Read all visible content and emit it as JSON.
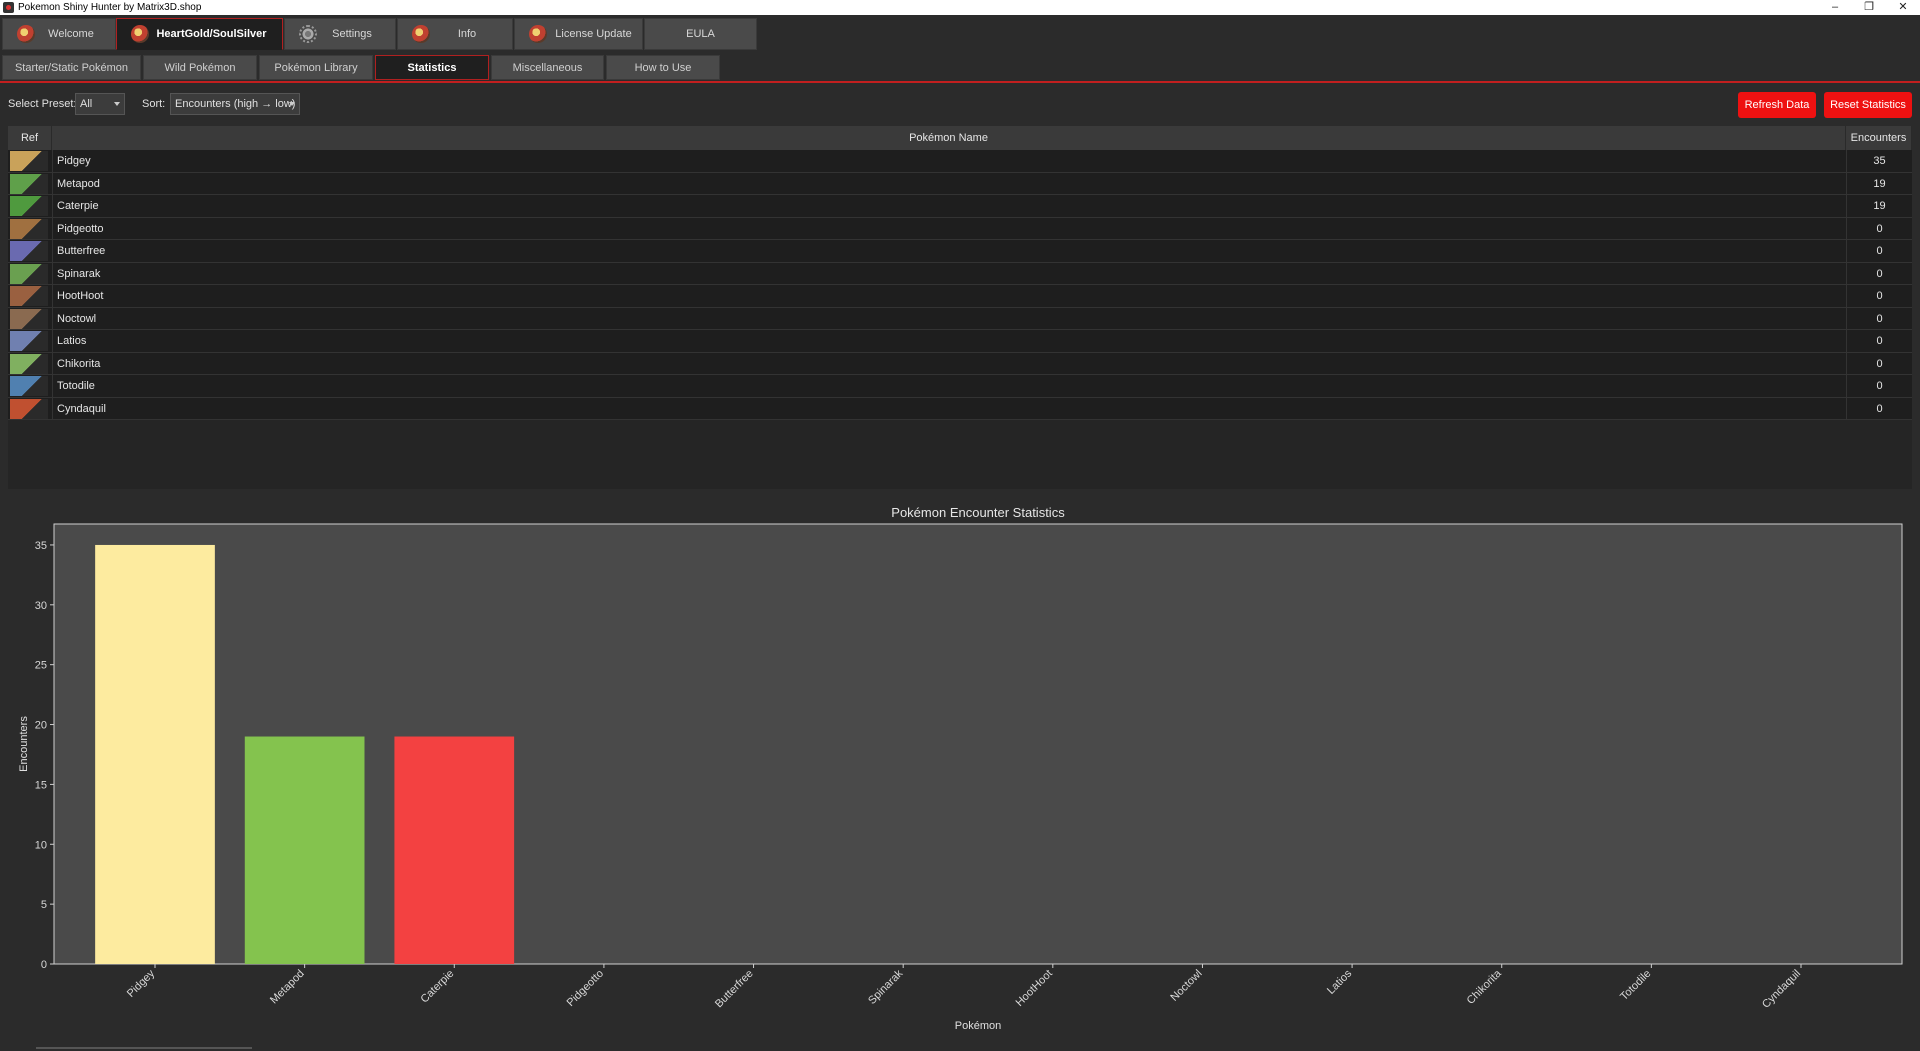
{
  "window": {
    "title": "Pokemon Shiny Hunter by Matrix3D.shop",
    "controls": [
      "minimize",
      "restore",
      "close"
    ]
  },
  "main_tabs": [
    {
      "label": "Welcome",
      "icon": "pokeball-icon"
    },
    {
      "label": "HeartGold/SoulSilver",
      "icon": "pokeball-icon",
      "active": true
    },
    {
      "label": "Settings",
      "icon": "gear-icon"
    },
    {
      "label": "Info",
      "icon": "pokeball-icon"
    },
    {
      "label": "License Update",
      "icon": "license-icon"
    },
    {
      "label": "EULA"
    }
  ],
  "sub_tabs": [
    {
      "label": "Starter/Static Pokémon"
    },
    {
      "label": "Wild Pokémon"
    },
    {
      "label": "Pokémon Library"
    },
    {
      "label": "Statistics",
      "active": true
    },
    {
      "label": "Miscellaneous"
    },
    {
      "label": "How to Use"
    }
  ],
  "toolbar": {
    "preset_label": "Select Preset:",
    "preset_value": "All",
    "sort_label": "Sort:",
    "sort_value": "Encounters (high → low)",
    "refresh_label": "Refresh Data",
    "reset_label": "Reset Statistics"
  },
  "table": {
    "columns": [
      "Ref",
      "Pokémon Name",
      "Encounters"
    ],
    "rows": [
      {
        "name": "Pidgey",
        "encounters": "35",
        "sprite_color": "#c9a25a"
      },
      {
        "name": "Metapod",
        "encounters": "19",
        "sprite_color": "#5fa04a"
      },
      {
        "name": "Caterpie",
        "encounters": "19",
        "sprite_color": "#4f9a3e"
      },
      {
        "name": "Pidgeotto",
        "encounters": "0",
        "sprite_color": "#a07040"
      },
      {
        "name": "Butterfree",
        "encounters": "0",
        "sprite_color": "#6a6ab0"
      },
      {
        "name": "Spinarak",
        "encounters": "0",
        "sprite_color": "#6aa050"
      },
      {
        "name": "HootHoot",
        "encounters": "0",
        "sprite_color": "#9a6040"
      },
      {
        "name": "Noctowl",
        "encounters": "0",
        "sprite_color": "#8a6a50"
      },
      {
        "name": "Latios",
        "encounters": "0",
        "sprite_color": "#7080b0"
      },
      {
        "name": "Chikorita",
        "encounters": "0",
        "sprite_color": "#80b060"
      },
      {
        "name": "Totodile",
        "encounters": "0",
        "sprite_color": "#5080b0"
      },
      {
        "name": "Cyndaquil",
        "encounters": "0",
        "sprite_color": "#c05030"
      }
    ]
  },
  "colors": {
    "accent_red": "#ee1111",
    "bar_colors": [
      "#fdeb9f",
      "#84c34e",
      "#f34141"
    ],
    "plot_bg": "#4a4a4a"
  },
  "chart_data": {
    "type": "bar",
    "title": "Pokémon Encounter Statistics",
    "xlabel": "Pokémon",
    "ylabel": "Encounters",
    "categories": [
      "Pidgey",
      "Metapod",
      "Caterpie",
      "Pidgeotto",
      "Butterfree",
      "Spinarak",
      "HootHoot",
      "Noctowl",
      "Latios",
      "Chikorita",
      "Totodile",
      "Cyndaquil"
    ],
    "values": [
      35,
      19,
      19,
      0,
      0,
      0,
      0,
      0,
      0,
      0,
      0,
      0
    ],
    "ylim": [
      0,
      36.75
    ],
    "yticks": [
      0,
      5,
      10,
      15,
      20,
      25,
      30,
      35
    ],
    "grid": false,
    "legend": "none"
  }
}
